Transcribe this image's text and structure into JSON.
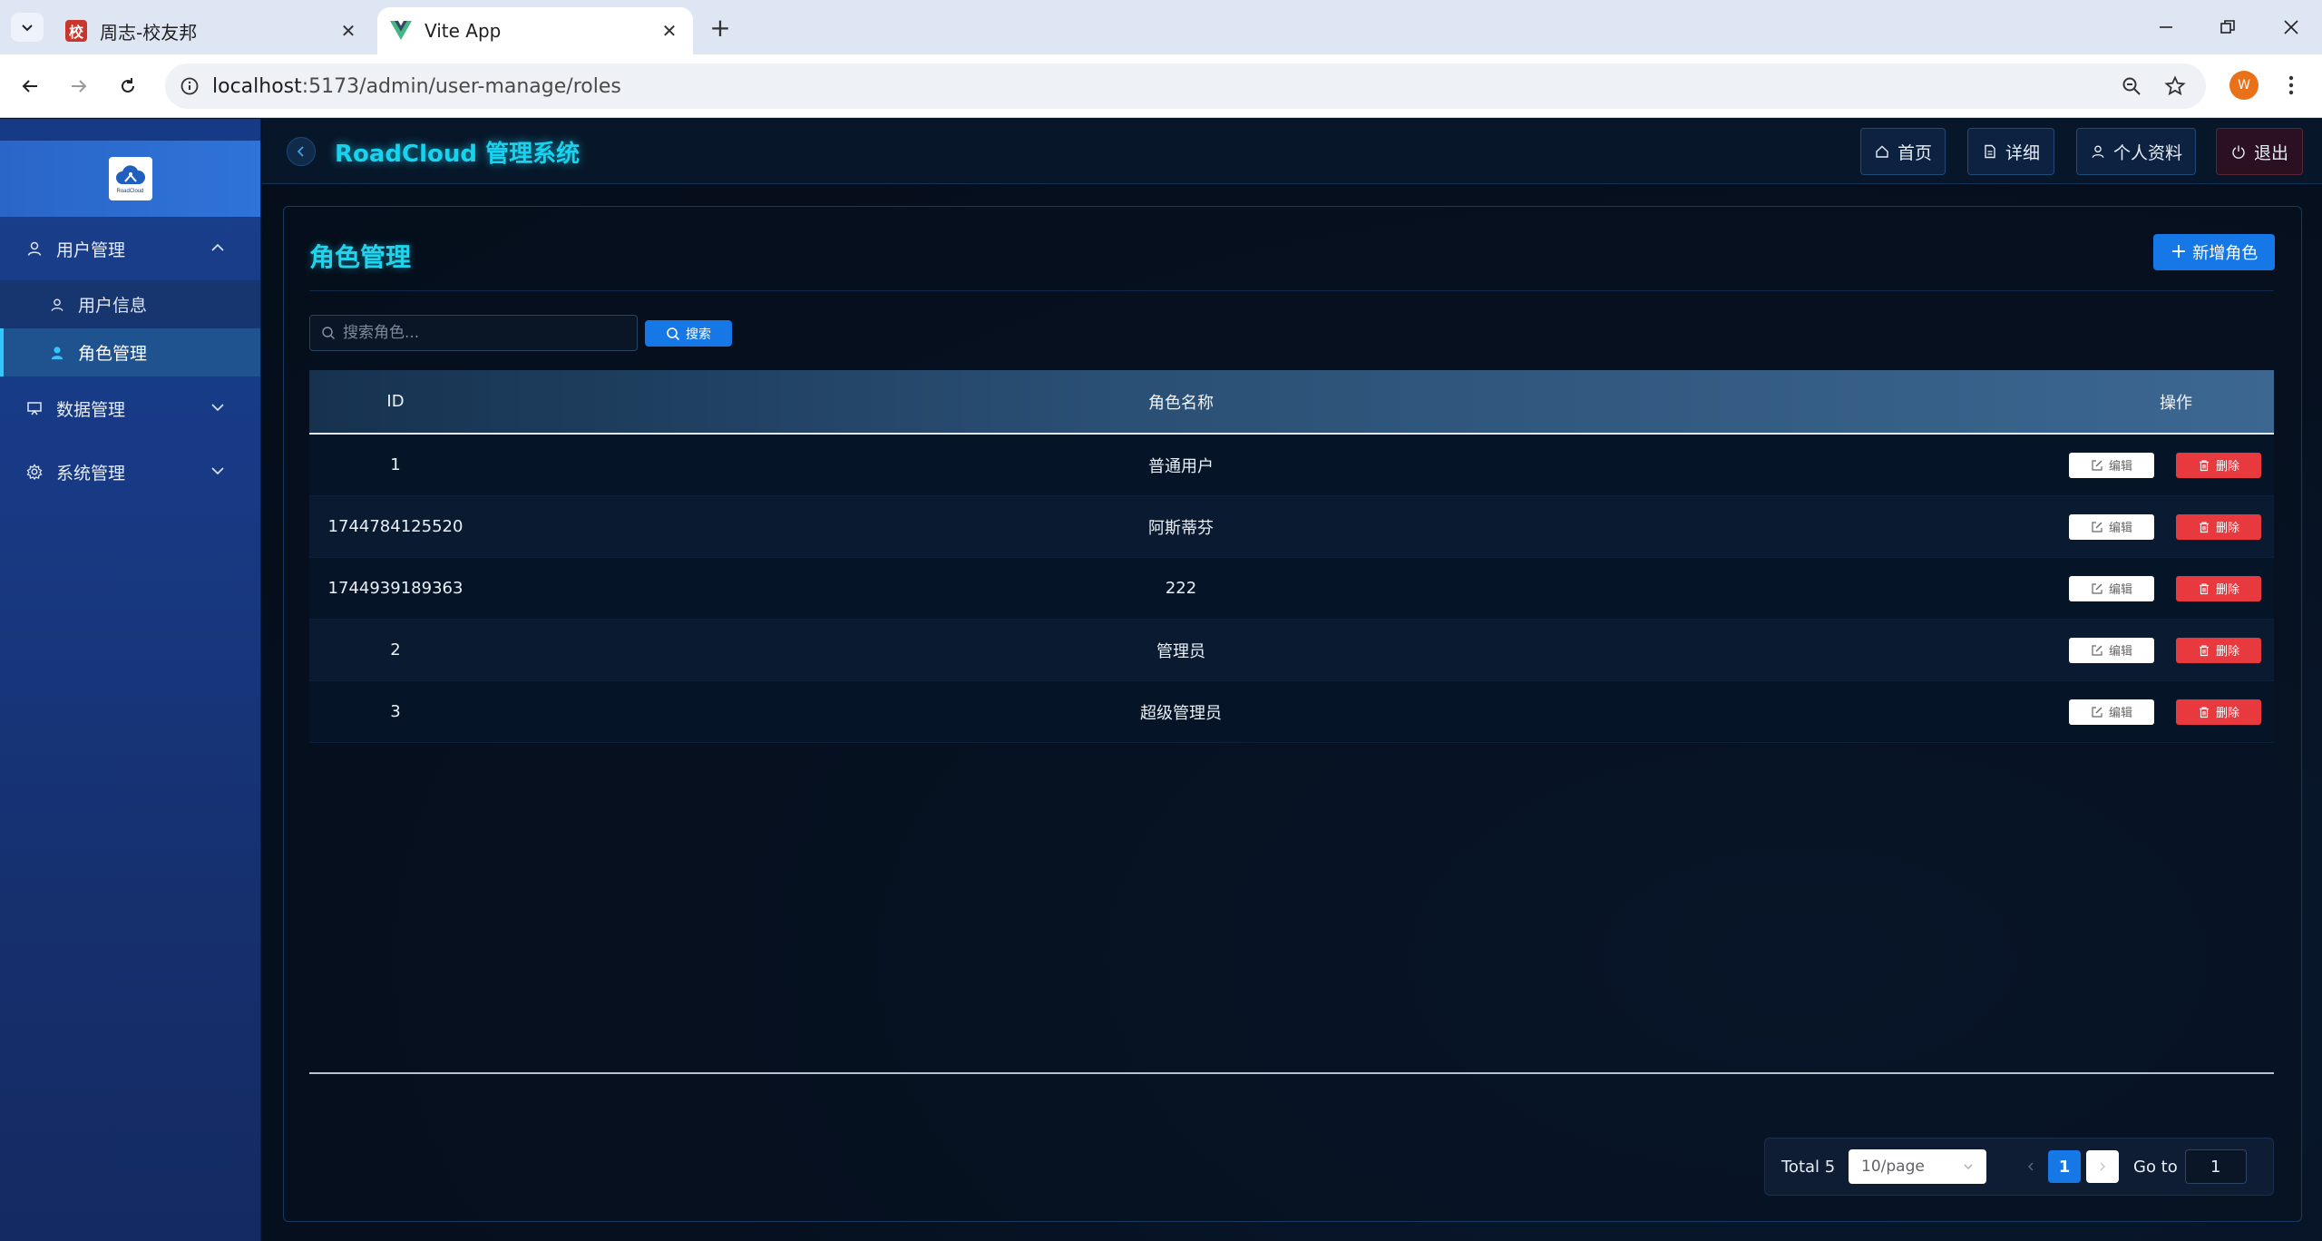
{
  "browser": {
    "tabs": [
      {
        "title": "周志-校友邦",
        "favicon": "校",
        "active": false
      },
      {
        "title": "Vite App",
        "favicon": "vue-logo",
        "active": true
      }
    ],
    "url_host": "localhost",
    "url_rest": ":5173/admin/user-manage/roles",
    "profile_initial": "W"
  },
  "app": {
    "title": "RoadCloud 管理系统",
    "logo_text": "RoadCloud",
    "topnav": [
      {
        "label": "首页",
        "icon": "home-icon"
      },
      {
        "label": "详细",
        "icon": "document-icon"
      },
      {
        "label": "个人资料",
        "icon": "user-icon"
      },
      {
        "label": "退出",
        "icon": "power-icon"
      }
    ]
  },
  "sidebar": {
    "groups": [
      {
        "label": "用户管理",
        "icon": "user-icon",
        "expanded": true,
        "items": [
          {
            "label": "用户信息",
            "icon": "user-icon",
            "active": false
          },
          {
            "label": "角色管理",
            "icon": "user-filled-icon",
            "active": true
          }
        ]
      },
      {
        "label": "数据管理",
        "icon": "monitor-icon",
        "expanded": false
      },
      {
        "label": "系统管理",
        "icon": "gear-icon",
        "expanded": false
      }
    ]
  },
  "page": {
    "title": "角色管理",
    "add_button": "新增角色",
    "search_placeholder": "搜索角色...",
    "search_button": "搜索"
  },
  "table": {
    "headers": {
      "id": "ID",
      "name": "角色名称",
      "ops": "操作"
    },
    "rows": [
      {
        "id": "1",
        "name": "普通用户"
      },
      {
        "id": "1744784125520",
        "name": "阿斯蒂芬"
      },
      {
        "id": "1744939189363",
        "name": "222"
      },
      {
        "id": "2",
        "name": "管理员"
      },
      {
        "id": "3",
        "name": "超级管理员"
      }
    ],
    "edit_label": "编辑",
    "delete_label": "删除"
  },
  "pagination": {
    "total_text": "Total 5",
    "page_size": "10/page",
    "current_page": "1",
    "goto_label": "Go to",
    "goto_value": "1"
  },
  "colors": {
    "accent": "#1677e6",
    "title_cyan": "#22d3ee",
    "danger": "#e8393e",
    "sidebar_bg": "#1a3f8a"
  }
}
